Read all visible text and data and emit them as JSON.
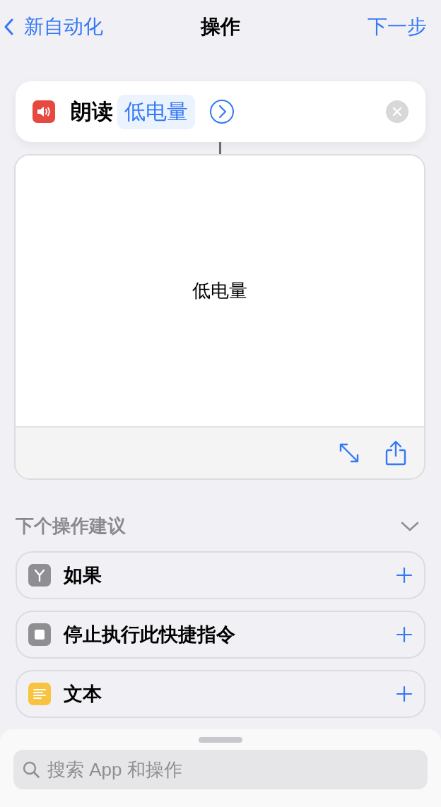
{
  "nav": {
    "back": "新自动化",
    "title": "操作",
    "next": "下一步"
  },
  "action": {
    "verb": "朗读",
    "token": "低电量"
  },
  "text_card": {
    "content": "低电量"
  },
  "suggestions": {
    "heading": "下个操作建议",
    "expanded": true,
    "items": [
      {
        "kind": "if",
        "label": "如果"
      },
      {
        "kind": "stop",
        "label": "停止执行此快捷指令"
      },
      {
        "kind": "text",
        "label": "文本"
      }
    ]
  },
  "search": {
    "placeholder": "搜索 App 和操作"
  }
}
